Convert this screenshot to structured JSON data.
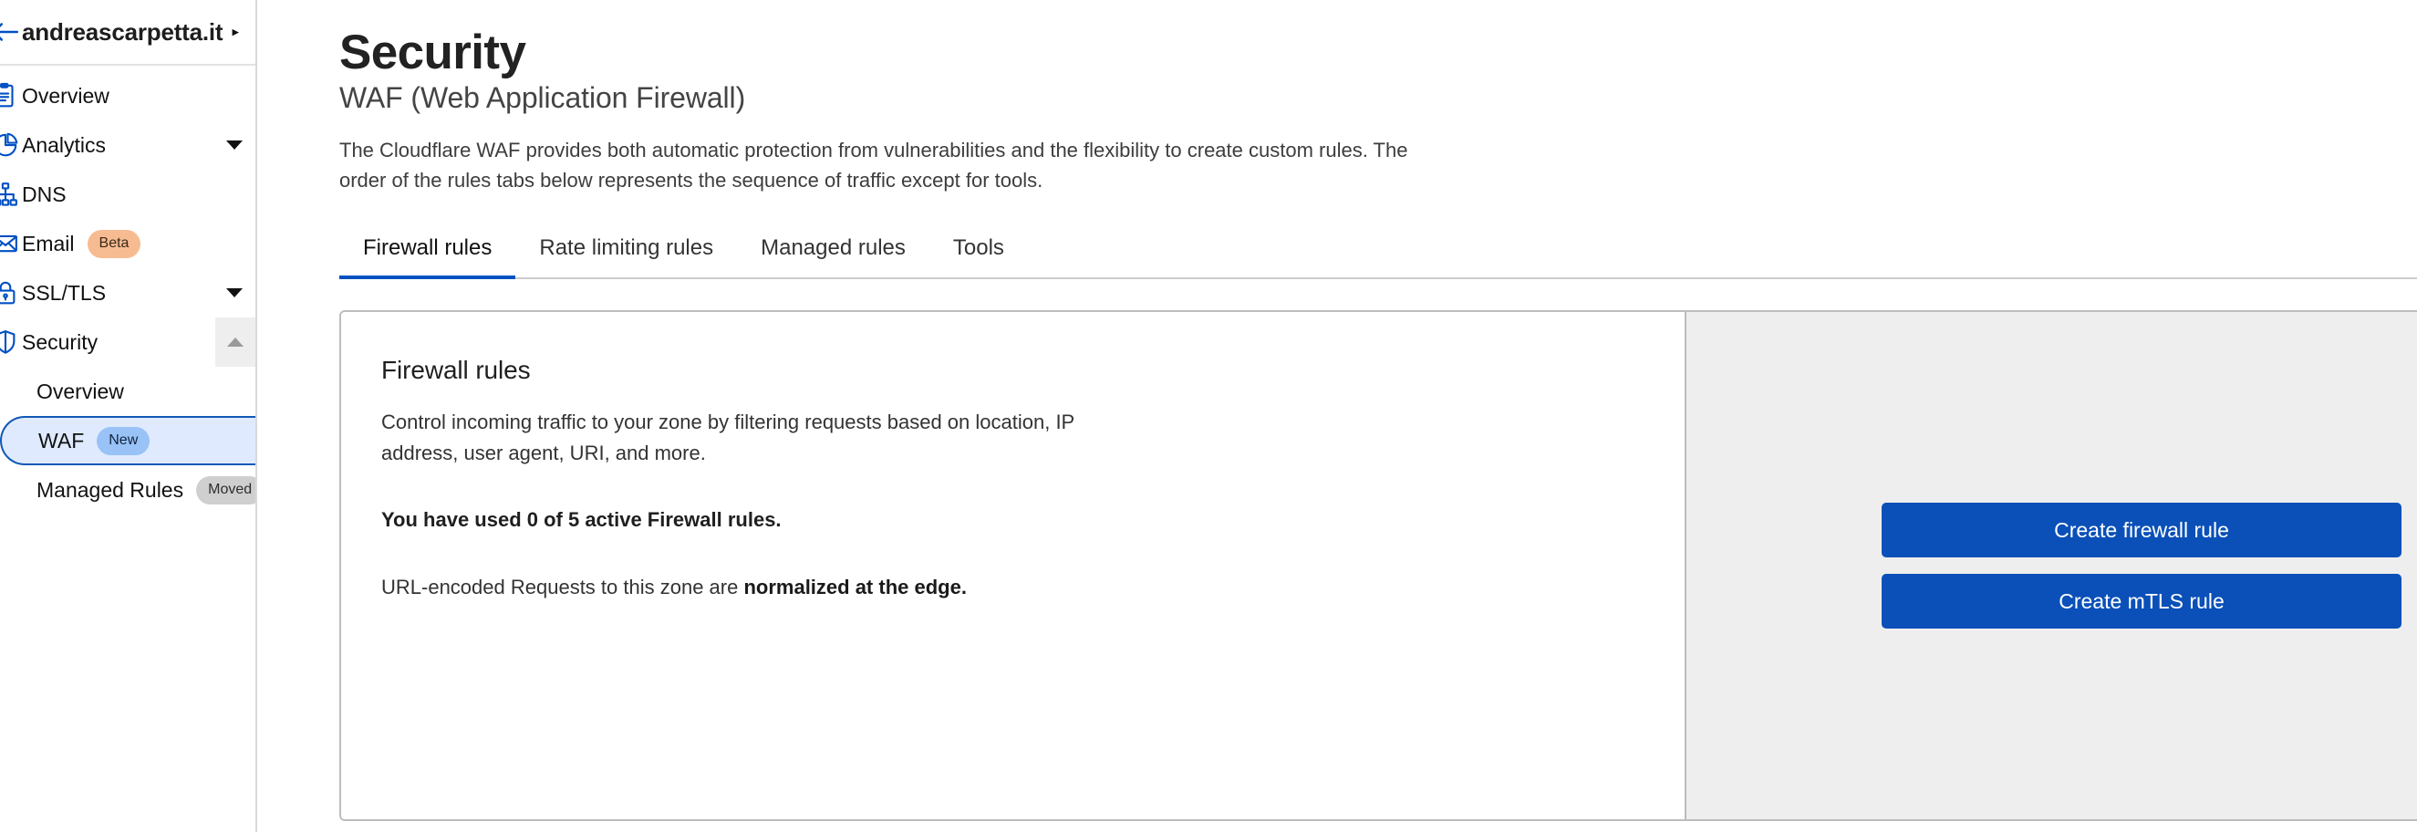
{
  "sidebar": {
    "back_icon": "back-arrow-icon",
    "zone_name": "andreascarpetta.it",
    "zone_caret": "▸",
    "items": [
      {
        "label": "Overview",
        "icon": "clipboard-icon",
        "chevron": false
      },
      {
        "label": "Analytics",
        "icon": "pie-chart-icon",
        "chevron": true
      },
      {
        "label": "DNS",
        "icon": "dns-tree-icon",
        "chevron": false
      },
      {
        "label": "Email",
        "icon": "envelope-icon",
        "chevron": false,
        "badge": "Beta"
      },
      {
        "label": "SSL/TLS",
        "icon": "lock-icon",
        "chevron": true
      },
      {
        "label": "Security",
        "icon": "shield-icon",
        "collapse": true
      }
    ],
    "security_children": [
      {
        "label": "Overview",
        "active": false
      },
      {
        "label": "WAF",
        "active": true,
        "badge": "New"
      },
      {
        "label": "Managed Rules",
        "active": false,
        "badge": "Moved"
      }
    ]
  },
  "main": {
    "title": "Security",
    "subtitle": "WAF (Web Application Firewall)",
    "description": "The Cloudflare WAF provides both automatic protection from vulnerabilities and the flexibility to create custom rules. The order of the rules tabs below represents the sequence of traffic except for tools.",
    "tabs": [
      {
        "label": "Firewall rules",
        "active": true
      },
      {
        "label": "Rate limiting rules",
        "active": false
      },
      {
        "label": "Managed rules",
        "active": false
      },
      {
        "label": "Tools",
        "active": false
      }
    ],
    "card": {
      "title": "Firewall rules",
      "body": "Control incoming traffic to your zone by filtering requests based on location, IP address, user agent, URI, and more.",
      "usage": "You have used 0 of 5 active Firewall rules.",
      "normalization_prefix": "URL-encoded Requests to this zone are ",
      "normalization_strong": "normalized at the edge.",
      "buttons": [
        {
          "label": "Create firewall rule"
        },
        {
          "label": "Create mTLS rule"
        }
      ]
    }
  },
  "colors": {
    "accent": "#0051c3",
    "button": "#0a50b8",
    "active_nav_bg": "#dfeaff",
    "active_nav_border": "#1158b5",
    "badge_beta": "#f7bb92",
    "badge_new": "#99c2f7",
    "badge_moved": "#cfcfcf",
    "panel_bg": "#eeeeee"
  }
}
